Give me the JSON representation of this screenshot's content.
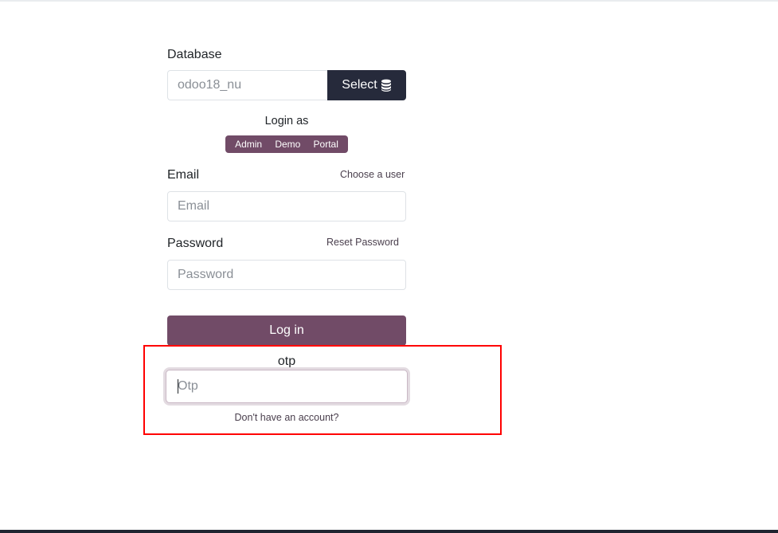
{
  "database": {
    "label": "Database",
    "value": "odoo18_nu",
    "select_button_label": "Select",
    "select_icon": "database-icon"
  },
  "login_as": {
    "label": "Login as",
    "options": [
      "Admin",
      "Demo",
      "Portal"
    ]
  },
  "email": {
    "label": "Email",
    "link": "Choose a user",
    "placeholder": "Email"
  },
  "password": {
    "label": "Password",
    "link": "Reset Password",
    "placeholder": "Password"
  },
  "login_button": "Log in",
  "otp": {
    "label": "otp",
    "placeholder": "Otp"
  },
  "signup_link": "Don't have an account?",
  "colors": {
    "primary": "#714b67",
    "dark_button": "#262a3b",
    "highlight": "#ff0000"
  }
}
